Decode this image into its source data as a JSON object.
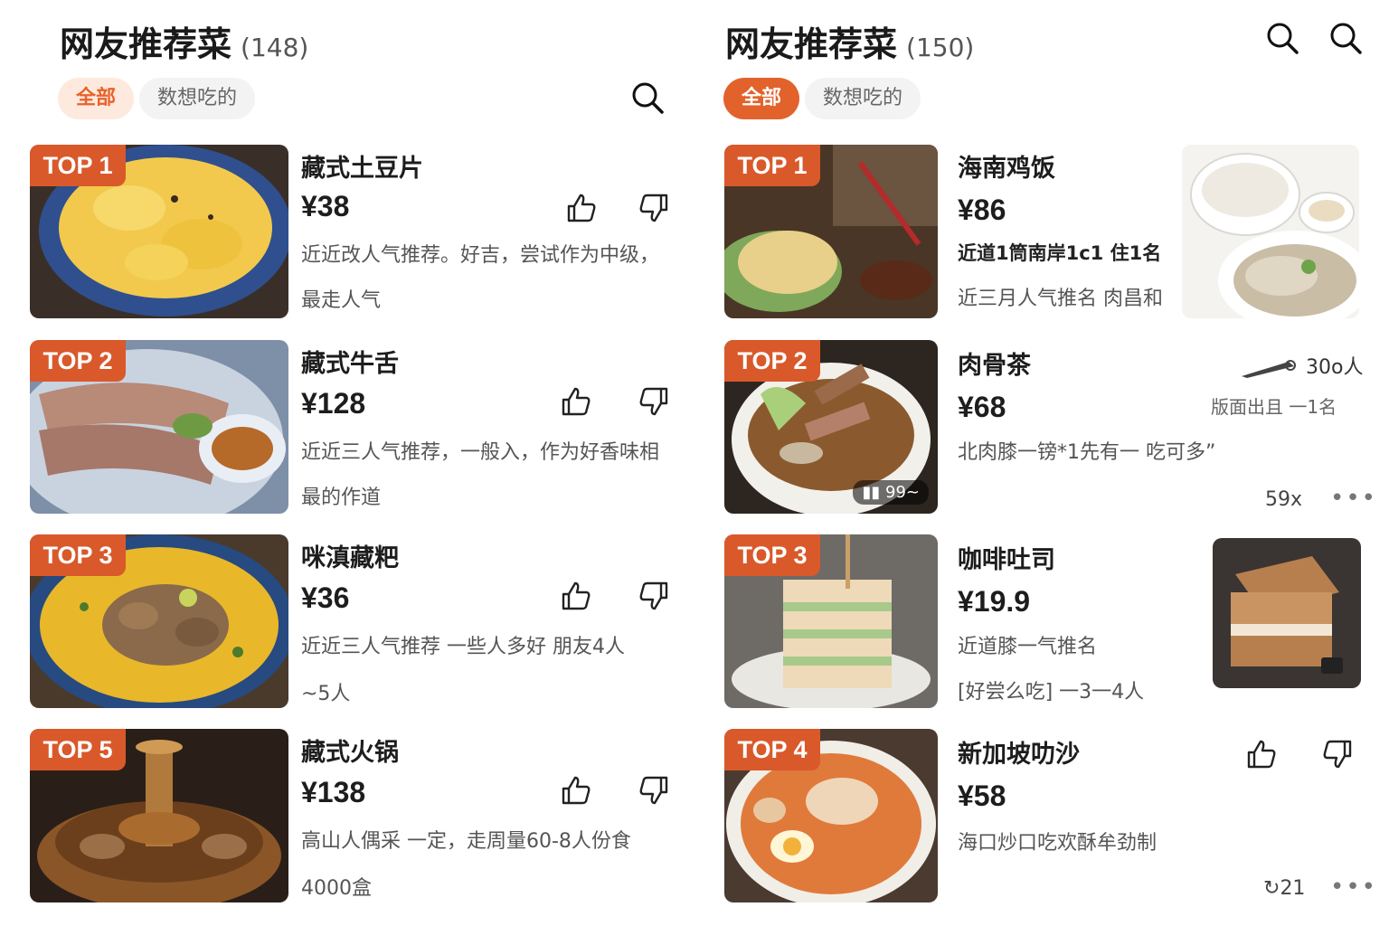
{
  "left": {
    "title": "网友推荐菜",
    "count": "(148)",
    "tabs": {
      "all": "全部",
      "want": "数想吃的"
    },
    "items": [
      {
        "rank": "TOP 1",
        "name": "藏式土豆片",
        "price": "¥38",
        "desc1": "近近改人气推荐。好吉，尝试作为中级，",
        "desc2": "最走人气"
      },
      {
        "rank": "TOP 2",
        "name": "藏式牛舌",
        "price": "¥128",
        "desc1": "近近三人气推荐，一般入，作为好香味相",
        "desc2": "最的作道"
      },
      {
        "rank": "TOP 3",
        "name": "咪滇藏粑",
        "price": "¥36",
        "desc1": "近近三人气推荐 一些人多好 朋友4人",
        "desc2": "~5人"
      },
      {
        "rank": "TOP 5",
        "name": "藏式火锅",
        "price": "¥138",
        "desc1": "高山人偶采 一定，走周量60-8人份食",
        "desc2": "4000盒"
      }
    ]
  },
  "right": {
    "title": "网友推荐菜",
    "count": "(150)",
    "tabs": {
      "all": "全部",
      "want": "数想吃的"
    },
    "items": [
      {
        "rank": "TOP 1",
        "name": "海南鸡饭",
        "price": "¥86",
        "desc1": "近道1筒南岸1c1 住1名",
        "desc2": "近三月人气推名 肉昌和"
      },
      {
        "rank": "TOP 2",
        "name": "肉骨茶",
        "price": "¥68",
        "desc1": "北肉膝一镑*1先有一 吃可多”",
        "views": "99~",
        "people": "30o人",
        "rank_note": "版面出且 一1名",
        "meta": "59x"
      },
      {
        "rank": "TOP 3",
        "name": "咖啡吐司",
        "price": "¥19.9",
        "desc1": "近道膝一气推名",
        "desc2": "[好尝么吃] 一3一4人"
      },
      {
        "rank": "TOP 4",
        "name": "新加坡叻沙",
        "price": "¥58",
        "desc1": "海口炒口吃欢酥牟劲制",
        "meta": "21"
      }
    ]
  },
  "colors": {
    "accent": "#e2622b",
    "badge": "#d9592b",
    "soft": "#fde9de"
  }
}
